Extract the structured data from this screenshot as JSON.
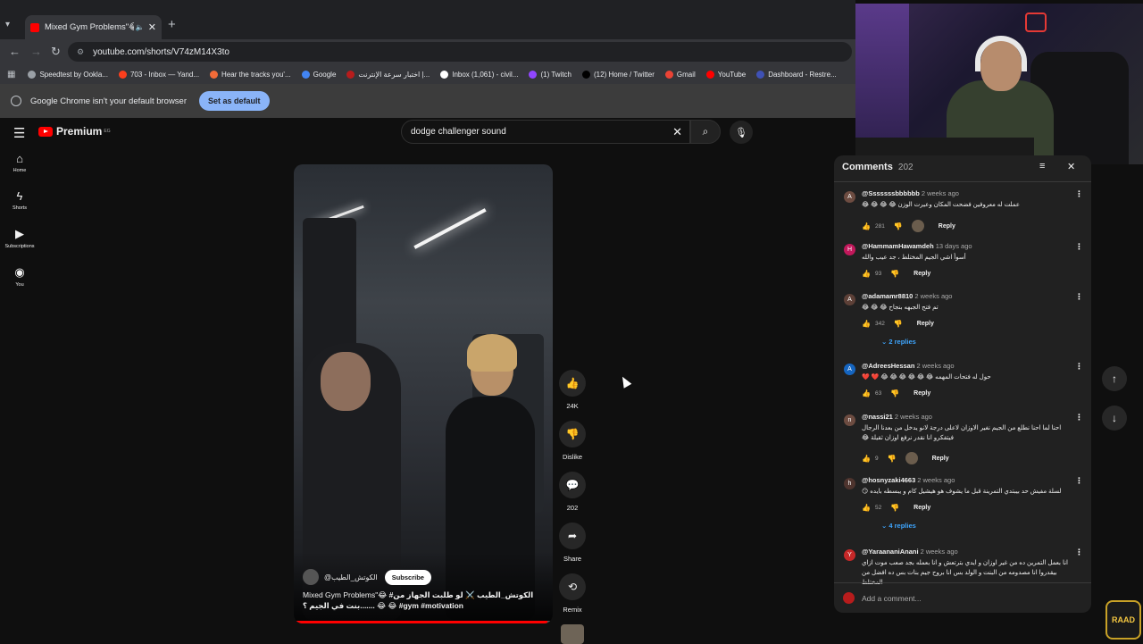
{
  "browser": {
    "tab_title": "Mixed Gym Problems\"😂 #",
    "url": "youtube.com/shorts/V74zM14X3to",
    "bookmarks": [
      {
        "label": "Speedtest by Ookla...",
        "color": "#9aa0a6"
      },
      {
        "label": "703 - Inbox — Yand...",
        "color": "#fc3f1d"
      },
      {
        "label": "Hear the tracks you'...",
        "color": "#f26b38"
      },
      {
        "label": "Google",
        "color": "#4285f4"
      },
      {
        "label": "اختبار سرعة الإنترنت |...",
        "color": "#b71c1c"
      },
      {
        "label": "Inbox (1,061) - civil...",
        "color": "#ffffff"
      },
      {
        "label": "(1) Twitch",
        "color": "#9146ff"
      },
      {
        "label": "(12) Home / Twitter",
        "color": "#000000"
      },
      {
        "label": "Gmail",
        "color": "#ea4335"
      },
      {
        "label": "YouTube",
        "color": "#ff0000"
      },
      {
        "label": "Dashboard - Restre...",
        "color": "#3f51b5"
      }
    ],
    "infobar_text": "Google Chrome isn't your default browser",
    "infobar_button": "Set as default"
  },
  "youtube": {
    "logo_text": "Premium",
    "logo_region": "EG",
    "search_value": "dodge challenger sound",
    "sidenav": [
      {
        "icon": "home-icon",
        "glyph": "⌂",
        "label": "Home"
      },
      {
        "icon": "shorts-icon",
        "glyph": "ϟ",
        "label": "Shorts"
      },
      {
        "icon": "subscriptions-icon",
        "glyph": "▶",
        "label": "Subscriptions"
      },
      {
        "icon": "you-icon",
        "glyph": "◉",
        "label": "You"
      }
    ]
  },
  "short": {
    "channel": "@الكوتش_الطيب",
    "subscribe_label": "Subscribe",
    "title_part1": "Mixed Gym Problems\"😂 ",
    "title_part2": "#الكوتش_الطيب ⚔️ لو طلبت الجهاز من بنت في الجيم ؟.......",
    "title_part3": "😂 😂 ",
    "title_tags": "#gym #motivation",
    "progress": 0.98
  },
  "actions": {
    "like_count": "24K",
    "dislike_label": "Dislike",
    "comments_count": "202",
    "share_label": "Share",
    "remix_label": "Remix"
  },
  "comments": {
    "header": "Comments",
    "count": "202",
    "add_placeholder": "Add a comment...",
    "items": [
      {
        "avatar": "A",
        "avatar_color": "#6d4c41",
        "author": "@Sssssssbbbbbb",
        "time": "2 weeks ago",
        "text": "عملت له معروفين فضحت المكان وعيرت الوزن 😂 😂 😂 😂",
        "likes": "281",
        "hearted": true,
        "replies": ""
      },
      {
        "avatar": "H",
        "avatar_color": "#c2185b",
        "author": "@HammamHawamdeh",
        "time": "13 days ago",
        "text": "أسوأ اشي الجيم المختلط ، جد عيب والله",
        "likes": "93",
        "hearted": false,
        "replies": ""
      },
      {
        "avatar": "A",
        "avatar_color": "#5d4037",
        "author": "@adamamr8810",
        "time": "2 weeks ago",
        "text": "تم فتح الجبهه بنجاح 😂 😂 😂",
        "likes": "342",
        "hearted": false,
        "replies": "2 replies"
      },
      {
        "avatar": "A",
        "avatar_color": "#1565c0",
        "author": "@AdreesHessan",
        "time": "2 weeks ago",
        "text": "حول له فتحات المهمه 😂 😂 😂 😂 😂 😂 ❤️ ❤️",
        "likes": "63",
        "hearted": false,
        "replies": ""
      },
      {
        "avatar": "n",
        "avatar_color": "#6d4c41",
        "author": "@nassi21",
        "time": "2 weeks ago",
        "text": "احنا لما احنا نطلع من الجيم نغير الاوزان لاعلى درجة لانو يدخل من بعدنا الرجال فيتفكرو انا نقدر نرفع اوزان ثقيلة 😂",
        "likes": "9",
        "hearted": true,
        "replies": ""
      },
      {
        "avatar": "h",
        "avatar_color": "#4e342e",
        "author": "@hosnyzaki4663",
        "time": "2 weeks ago",
        "text": "لسلة مفيش حد بيبتدي التمرينة قبل ما يشوف هو هيشيل كام و يبسطه بايده 😏",
        "likes": "52",
        "hearted": false,
        "replies": "4 replies"
      },
      {
        "avatar": "Y",
        "avatar_color": "#c62828",
        "author": "@YaraananiAnani",
        "time": "2 weeks ago",
        "text": "انا بعمل التمرين ده من غير اوزان و ايدي بترتعش و انا بعمله بجد صعب موت ازاي بيقدروا انا مصدومه من البنت و الولد بس انا بروح جيم بنات بس ده افضل من المختلط",
        "likes": "",
        "hearted": false,
        "replies": ""
      }
    ]
  }
}
